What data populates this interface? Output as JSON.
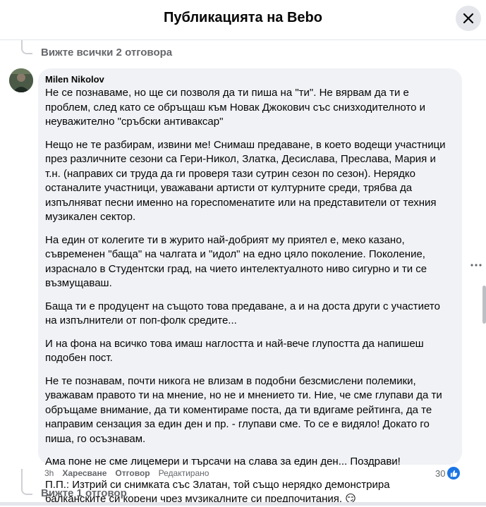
{
  "header": {
    "title": "Публикацията на Bebo"
  },
  "thread": {
    "see_all_replies": "Вижте всички 2 отговора",
    "see_one_reply": "Вижте 1 отговор"
  },
  "comment": {
    "author": "Milen Nikolov",
    "paragraphs": [
      "Не се познаваме, но ще си позволя да ти пиша на \"ти\". Не вярвам да ти е проблем, след като се обръщаш към Новак Джокович със снизходителното и неуважително \"сръбски антиваксар\"",
      "Нещо не те разбирам, извини ме! Снимаш предаване, в което водещи участници през различните сезони са Гери-Никол, Златка, Десислава, Преслава, Мария и т.н. (направих си труда да ги проверя тази сутрин сезон по сезон). Нерядко останалите участници, уважавани артисти от културните среди, трябва да изпълняват песни именно на гореспоменатите или на представители от техния музикален сектор.",
      "На един от колегите ти в журито най-добрият му приятел е, меко казано, съвременен \"баща\" на чалгата и \"идол\" на едно цяло поколение. Поколение, израснало в Студентски град, на чието интелектуалното ниво сигурно и ти се възмущаваш.",
      "Баща ти е продуцент на същото това предаване, а и на доста други с участието на изпълнители от поп-фолк средите...",
      "И на фона на всичко това имаш наглостта и най-вече глупостта да напишеш подобен пост.",
      "Не те познавам, почти никога не влизам в подобни безсмислени полемики, уважавам правото ти на мнение, но не и мнението ти. Ние, че сме глупави да ти обръщаме внимание, да ти коментираме поста, да ти вдигаме рейтинга, да те направим сензация за един ден и пр. - глупави сме. То се е видяло! Докато го пиша, го осъзнавам.",
      "Ама поне не сме лицемери и търсачи на слава за един ден... Поздрави!",
      "П.П.: Изтрий си снимката със Златан, той също нерядко демонстрира балканските си корени чрез музикалните си предпочитания. 😏"
    ],
    "time": "3h",
    "like_label": "Харесване",
    "reply_label": "Отговор",
    "edited_label": "Редактирано",
    "like_count": "30"
  },
  "colors": {
    "bubble_bg": "#f0f2f5",
    "secondary_text": "#65676b",
    "like_blue": "#1b74e4"
  }
}
